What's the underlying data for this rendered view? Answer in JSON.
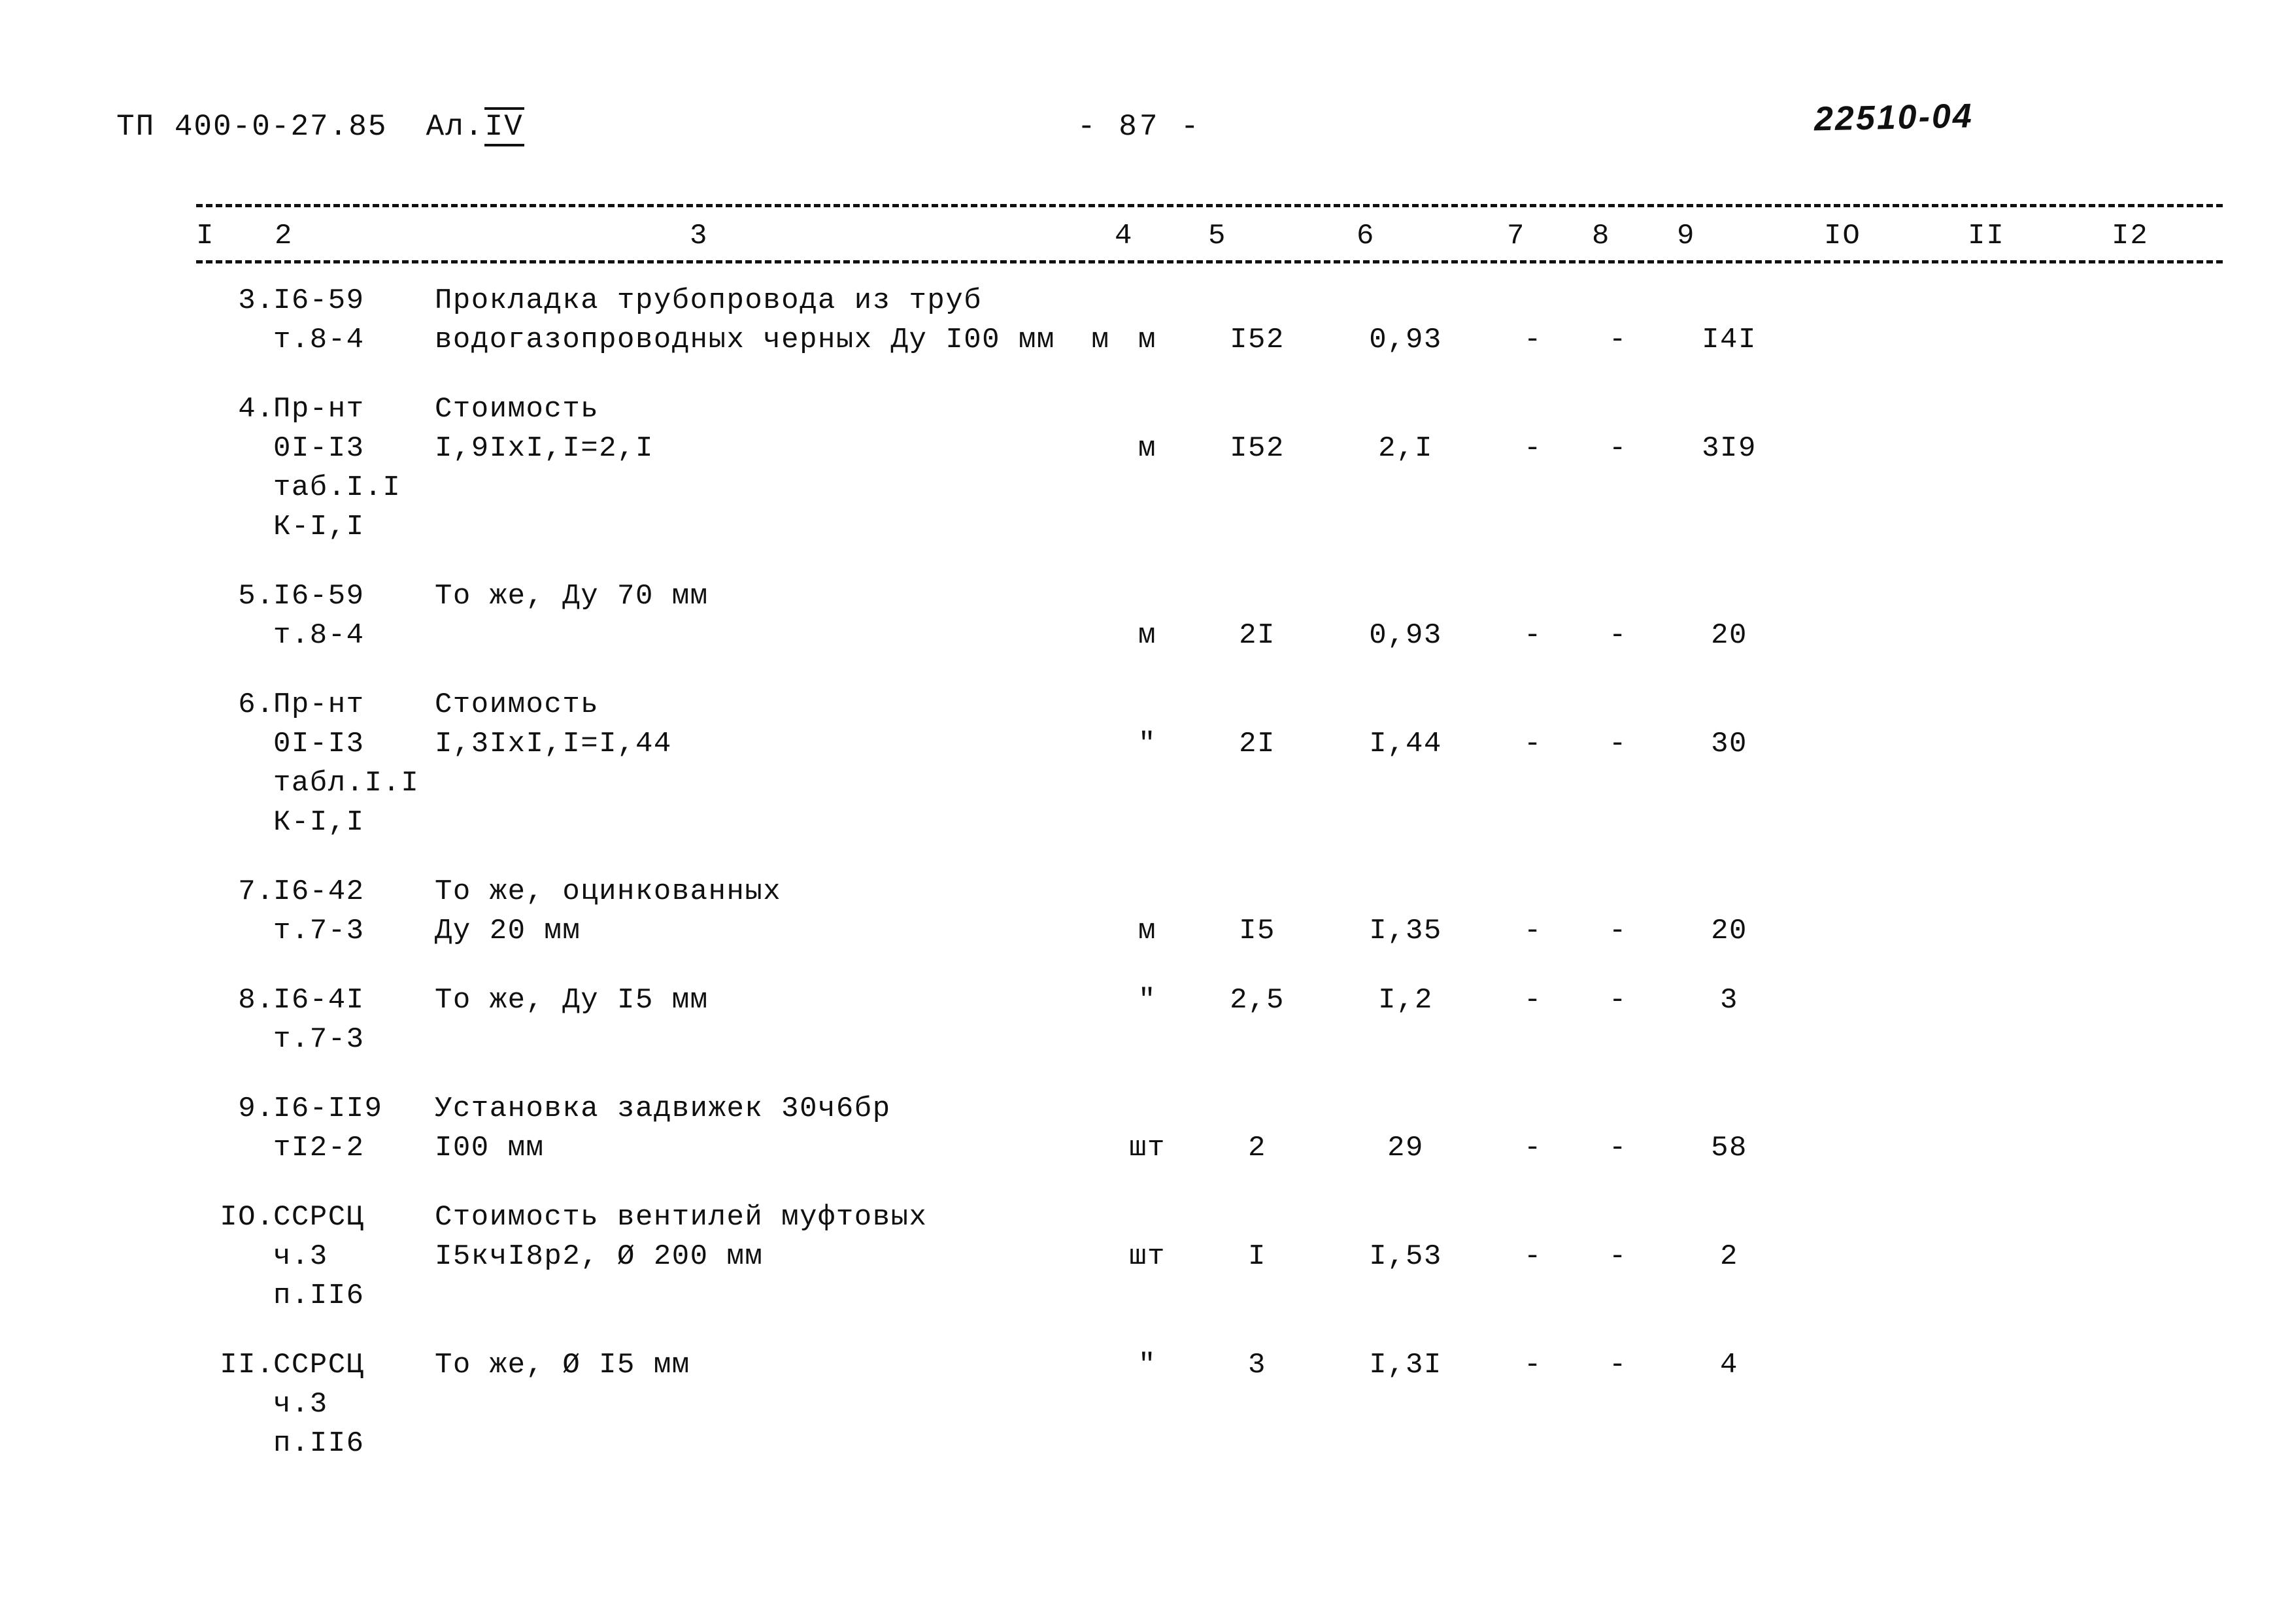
{
  "header": {
    "doc_code": "ТП 400-0-27.85  Ал.",
    "doc_code_album": "IV",
    "page_number": "- 87 -",
    "stamp_number": "22510-04"
  },
  "table": {
    "column_numbers": [
      "I",
      "2",
      "3",
      "4",
      "5",
      "6",
      "7",
      "8",
      "9",
      "IO",
      "II",
      "I2"
    ],
    "rows": [
      {
        "no": "3.",
        "code": [
          "I6-59",
          "т.8-4"
        ],
        "desc": [
          "Прокладка трубопровода из труб",
          "водогазопроводных черных Ду I00 мм  м"
        ],
        "unit": "м",
        "col5": "I52",
        "col6": "0,93",
        "col7": "-",
        "col8": "-",
        "col9": "I4I",
        "value_line": 1
      },
      {
        "no": "4.",
        "code": [
          "Пр-нт",
          "0I-I3",
          "таб.I.I",
          "К-I,I"
        ],
        "desc": [
          "Стоимость",
          "I,9IхI,I=2,I"
        ],
        "unit": "м",
        "col5": "I52",
        "col6": "2,I",
        "col7": "-",
        "col8": "-",
        "col9": "3I9",
        "value_line": 1
      },
      {
        "no": "5.",
        "code": [
          "I6-59",
          "т.8-4"
        ],
        "desc": [
          "То же, Ду 70 мм"
        ],
        "unit": "м",
        "col5": "2I",
        "col6": "0,93",
        "col7": "-",
        "col8": "-",
        "col9": "20",
        "value_line": 1
      },
      {
        "no": "6.",
        "code": [
          "Пр-нт",
          "0I-I3",
          "табл.I.I",
          "К-I,I"
        ],
        "desc": [
          "Стоимость",
          "I,3IхI,I=I,44"
        ],
        "unit": "\"",
        "col5": "2I",
        "col6": "I,44",
        "col7": "-",
        "col8": "-",
        "col9": "30",
        "value_line": 1
      },
      {
        "no": "7.",
        "code": [
          "I6-42",
          "т.7-3"
        ],
        "desc": [
          "То же, оцинкованных",
          "Ду 20 мм"
        ],
        "unit": "м",
        "col5": "I5",
        "col6": "I,35",
        "col7": "-",
        "col8": "-",
        "col9": "20",
        "value_line": 1
      },
      {
        "no": "8.",
        "code": [
          "I6-4I",
          "т.7-3"
        ],
        "desc": [
          "То же, Ду I5 мм"
        ],
        "unit": "\"",
        "col5": "2,5",
        "col6": "I,2",
        "col7": "-",
        "col8": "-",
        "col9": "3",
        "value_line": 0
      },
      {
        "no": "9.",
        "code": [
          "I6-II9",
          "тI2-2"
        ],
        "desc": [
          "Установка задвижек 30ч6бр",
          "I00 мм"
        ],
        "unit": "шт",
        "col5": "2",
        "col6": "29",
        "col7": "-",
        "col8": "-",
        "col9": "58",
        "value_line": 1
      },
      {
        "no": "IO.",
        "code": [
          "ССРСЦ",
          "ч.3",
          "п.II6"
        ],
        "desc": [
          "Стоимость вентилей муфтовых",
          "I5кчI8р2, Ø 200 мм"
        ],
        "unit": "шт",
        "col5": "I",
        "col6": "I,53",
        "col7": "-",
        "col8": "-",
        "col9": "2",
        "value_line": 1
      },
      {
        "no": "II.",
        "code": [
          "ССРСЦ",
          "ч.3",
          "п.II6"
        ],
        "desc": [
          "То же, Ø I5 мм"
        ],
        "unit": "\"",
        "col5": "3",
        "col6": "I,3I",
        "col7": "-",
        "col8": "-",
        "col9": "4",
        "value_line": 0
      }
    ]
  }
}
